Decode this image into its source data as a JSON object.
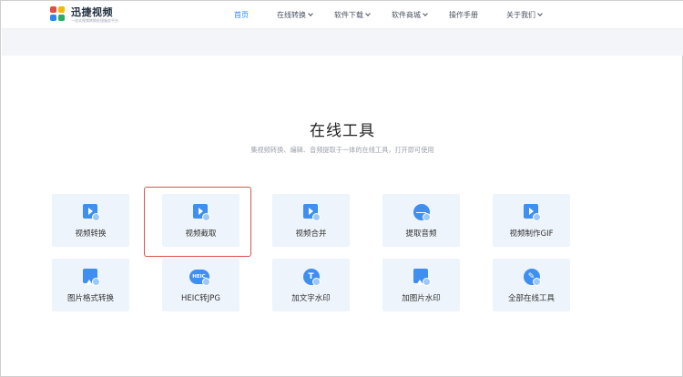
{
  "brand": {
    "name": "迅捷视频",
    "tagline": "一站式视频转换处理服务平台",
    "colors": [
      "#e74c3c",
      "#f5b800",
      "#2e86f5",
      "#27ae60"
    ]
  },
  "nav": {
    "items": [
      {
        "label": "首页",
        "active": true,
        "dropdown": false
      },
      {
        "label": "在线转换",
        "active": false,
        "dropdown": true
      },
      {
        "label": "软件下载",
        "active": false,
        "dropdown": true
      },
      {
        "label": "软件商城",
        "active": false,
        "dropdown": true
      },
      {
        "label": "操作手册",
        "active": false,
        "dropdown": false
      },
      {
        "label": "关于我们",
        "active": false,
        "dropdown": true
      }
    ]
  },
  "section": {
    "title": "在线工具",
    "subtitle": "集视频转换、编辑、音频提取于一体的在线工具，打开即可使用"
  },
  "tools": [
    {
      "label": "视频转换",
      "icon": "video-convert-icon"
    },
    {
      "label": "视频截取",
      "icon": "video-cut-icon"
    },
    {
      "label": "视频合并",
      "icon": "video-merge-icon"
    },
    {
      "label": "提取音频",
      "icon": "audio-extract-icon"
    },
    {
      "label": "视频制作GIF",
      "icon": "video-gif-icon"
    },
    {
      "label": "图片格式转换",
      "icon": "image-convert-icon"
    },
    {
      "label": "HEIC转JPG",
      "icon": "heic-icon"
    },
    {
      "label": "加文字水印",
      "icon": "text-watermark-icon"
    },
    {
      "label": "加图片水印",
      "icon": "image-watermark-icon"
    },
    {
      "label": "全部在线工具",
      "icon": "all-tools-icon"
    }
  ],
  "theme": {
    "accent": "#2e86f5",
    "card_bg": "#eef4fb",
    "highlight": "#d9534f"
  }
}
